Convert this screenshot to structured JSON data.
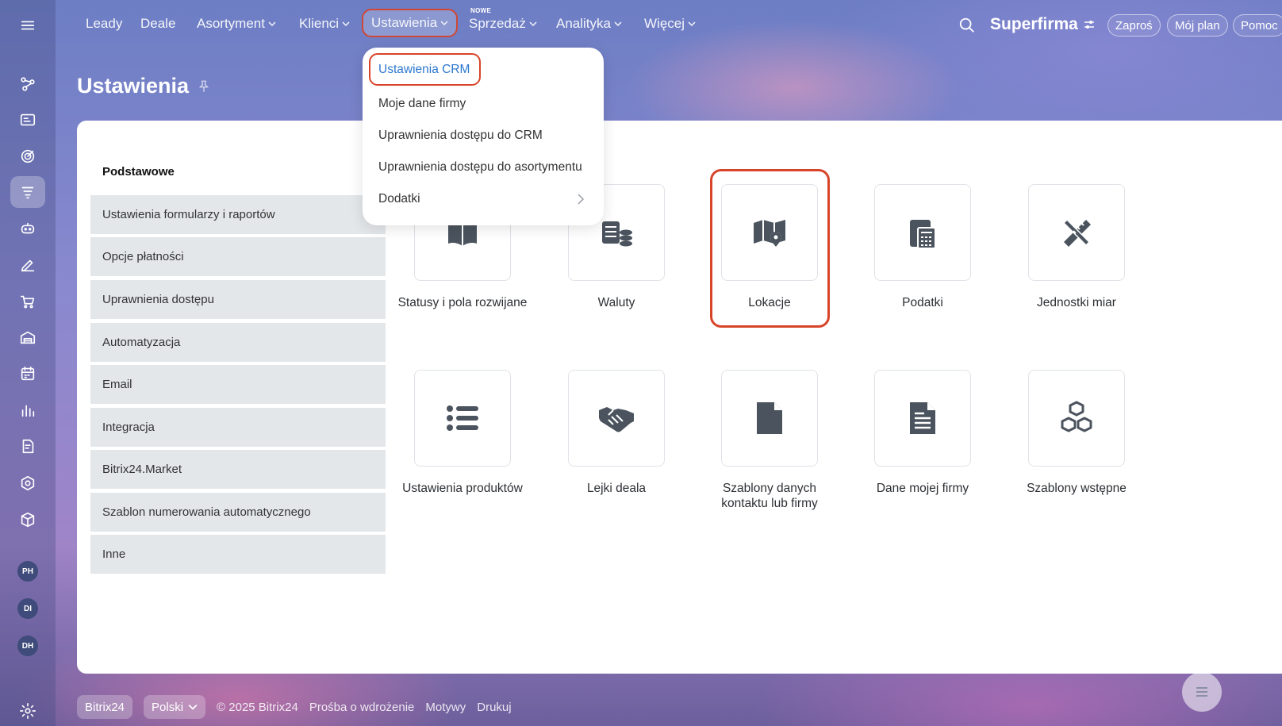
{
  "nav": {
    "items": [
      {
        "label": "Leady"
      },
      {
        "label": "Deale"
      },
      {
        "label": "Asortyment"
      },
      {
        "label": "Klienci"
      },
      {
        "label": "Ustawienia"
      },
      {
        "label": "Sprzedaż"
      },
      {
        "label": "Analityka"
      },
      {
        "label": "Więcej"
      }
    ],
    "new_badge": "NOWE",
    "brand": "Superfirma",
    "buttons": {
      "invite": "Zaproś",
      "plan": "Mój plan",
      "help": "Pomoc"
    }
  },
  "page": {
    "title": "Ustawienia"
  },
  "dropdown": {
    "items": [
      {
        "label": "Ustawienia CRM"
      },
      {
        "label": "Moje dane firmy"
      },
      {
        "label": "Uprawnienia dostępu do CRM"
      },
      {
        "label": "Uprawnienia dostępu do asortymentu"
      },
      {
        "label": "Dodatki"
      }
    ]
  },
  "sidebar": {
    "title": "Podstawowe",
    "items": [
      {
        "label": "Ustawienia formularzy i raportów"
      },
      {
        "label": "Opcje płatności"
      },
      {
        "label": "Uprawnienia dostępu"
      },
      {
        "label": "Automatyzacja"
      },
      {
        "label": "Email"
      },
      {
        "label": "Integracja"
      },
      {
        "label": "Bitrix24.Market"
      },
      {
        "label": "Szablon numerowania automatycznego"
      },
      {
        "label": "Inne"
      }
    ]
  },
  "tiles": [
    {
      "label": "Statusy i pola rozwijane",
      "icon": "book-icon"
    },
    {
      "label": "Waluty",
      "icon": "coins-icon"
    },
    {
      "label": "Lokacje",
      "icon": "map-pin-icon"
    },
    {
      "label": "Podatki",
      "icon": "calculator-icon"
    },
    {
      "label": "Jednostki miar",
      "icon": "ruler-pencil-icon"
    },
    {
      "label": "Ustawienia produktów",
      "icon": "list-icon"
    },
    {
      "label": "Lejki deala",
      "icon": "handshake-icon"
    },
    {
      "label": "Szablony danych kontaktu lub firmy",
      "icon": "file-icon"
    },
    {
      "label": "Dane mojej firmy",
      "icon": "document-icon"
    },
    {
      "label": "Szablony wstępne",
      "icon": "cubes-icon"
    }
  ],
  "avatars": [
    "PH",
    "DI",
    "DH"
  ],
  "footer": {
    "logo": "Bitrix24",
    "language": "Polski",
    "copyright": "© 2025 Bitrix24",
    "links": [
      "Prośba o wdrożenie",
      "Motywy",
      "Drukuj"
    ]
  },
  "colors": {
    "highlight": "#d8442a",
    "link": "#2c78cf"
  }
}
